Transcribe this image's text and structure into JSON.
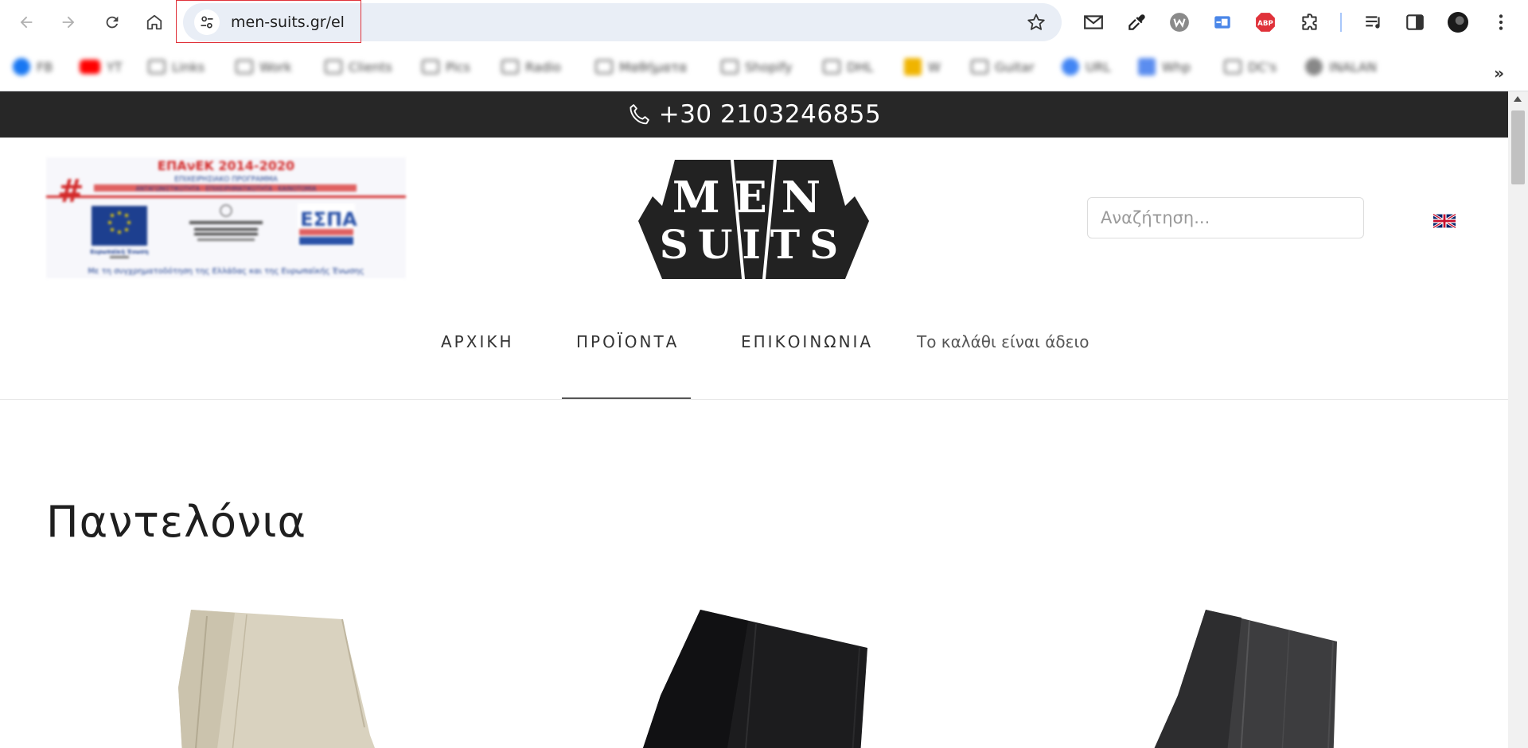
{
  "browser": {
    "url": "men-suits.gr/el",
    "bookmarks": [
      "FB",
      "YT",
      "Links",
      "Work",
      "Clients",
      "Pics",
      "Radio",
      "Μαθήματα",
      "Shopify",
      "DHL",
      "W",
      "Guitar",
      "URL",
      "Whp",
      "DC's",
      "INALAN"
    ]
  },
  "topbar": {
    "phone": "+30 2103246855"
  },
  "header": {
    "banner_title": "ΕΠΑνΕΚ 2014-2020",
    "banner_subtitle": "ΕΠΙΧΕΙΡΗΣΙΑΚΟ ΠΡΟΓΡΑΜΜΑ",
    "banner_program": "ΑΝΤΑΓΩΝΙΣΤΙΚΟΤΗΤΑ · ΕΠΙΧΕΙΡΗΜΑΤΙΚΟΤΗΤΑ · ΚΑΙΝΟΤΟΜΙΑ",
    "banner_eu": "Ευρωπαϊκή Ένωση",
    "banner_espa": "ΕΣΠΑ",
    "banner_footer": "Με τη συγχρηματοδότηση της Ελλάδας και της Ευρωπαϊκής Ένωσης",
    "logo_line1": "MEN",
    "logo_line2": "SUITS",
    "search_placeholder": "Αναζήτηση..."
  },
  "nav": {
    "home": "ΑΡΧΙΚΗ",
    "products": "ΠΡΟΪΟΝΤΑ",
    "contact": "ΕΠΙΚΟΙΝΩΝΙΑ",
    "cart": "Το καλάθι είναι άδειο"
  },
  "main": {
    "title": "Παντελόνια",
    "products": [
      {
        "color_name": "beige",
        "color": "#d9d2bf"
      },
      {
        "color_name": "black",
        "color": "#1c1c1e"
      },
      {
        "color_name": "charcoal",
        "color": "#3d3d3f"
      }
    ]
  },
  "colors": {
    "topbar_bg": "#272727",
    "url_highlight": "#e0323a",
    "omnibox_bg": "#e9eef6"
  }
}
